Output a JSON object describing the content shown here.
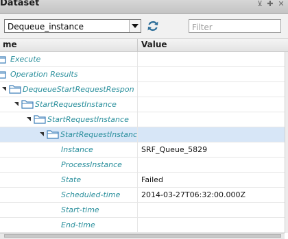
{
  "window": {
    "title": "Dataset",
    "controls": [
      "pin-icon",
      "add-icon",
      "close-icon"
    ]
  },
  "toolbar": {
    "dataset_select": {
      "value": "Dequeue_instance"
    },
    "refresh_icon": "refresh-icon",
    "filter": {
      "placeholder": "Filter",
      "value": ""
    }
  },
  "table": {
    "columns": [
      "me",
      "Value"
    ],
    "rows": [
      {
        "label": "Execute",
        "value": ""
      },
      {
        "label": "Operation Results",
        "value": ""
      },
      {
        "label": "DequeueStartRequestRespon",
        "value": ""
      },
      {
        "label": "StartRequestInstance",
        "value": ""
      },
      {
        "label": "StartRequestInstance",
        "value": ""
      },
      {
        "label": "StartRequestInstanc",
        "value": "",
        "selected": true
      },
      {
        "label": "Instance",
        "value": "SRF_Queue_5829"
      },
      {
        "label": "ProcessInstance",
        "value": ""
      },
      {
        "label": "State",
        "value": "Failed"
      },
      {
        "label": "Scheduled-time",
        "value": "2014-03-27T06:32:00.000Z"
      },
      {
        "label": "Start-time",
        "value": ""
      },
      {
        "label": "End-time",
        "value": ""
      }
    ]
  },
  "colors": {
    "label": "#2a8f9c",
    "selection": "#d7e6f7",
    "folder": "#3d7fb9"
  }
}
